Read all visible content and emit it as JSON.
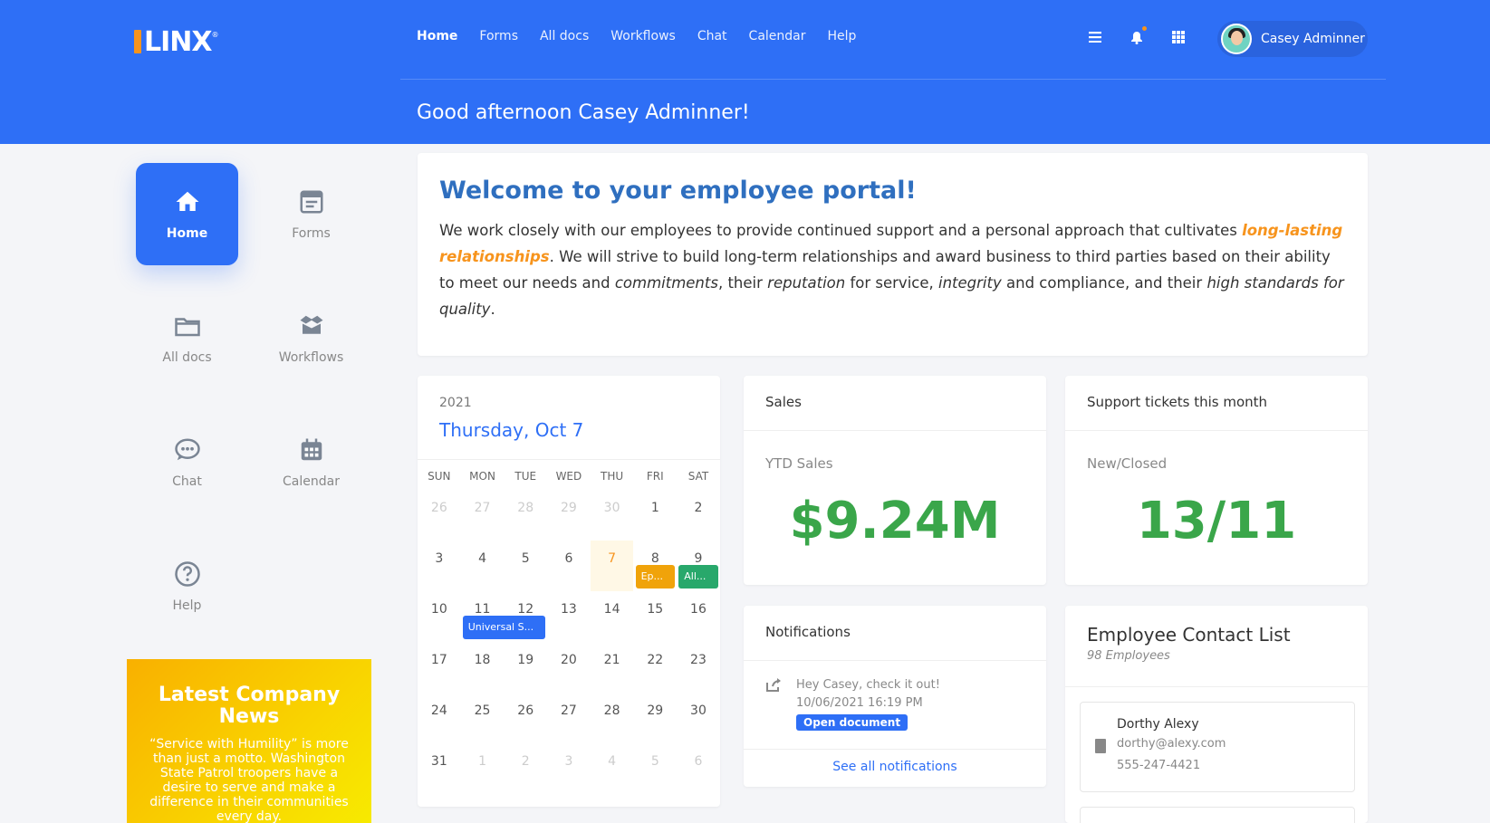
{
  "brand": {
    "logo_text": "LINX",
    "reg_mark": "®"
  },
  "nav": {
    "items": [
      "Home",
      "Forms",
      "All docs",
      "Workflows",
      "Chat",
      "Calendar",
      "Help"
    ],
    "active": "Home"
  },
  "header_icons": [
    "menu-icon",
    "bell-icon",
    "grid-icon"
  ],
  "user": {
    "name": "Casey Adminner"
  },
  "greeting": "Good afternoon Casey Adminner!",
  "sidebar": {
    "items": [
      {
        "label": "Home",
        "icon": "home-icon",
        "active": true
      },
      {
        "label": "Forms",
        "icon": "form-icon"
      },
      {
        "label": "All docs",
        "icon": "folder-icon"
      },
      {
        "label": "Workflows",
        "icon": "box-icon"
      },
      {
        "label": "Chat",
        "icon": "chat-icon"
      },
      {
        "label": "Calendar",
        "icon": "calendar-icon"
      },
      {
        "label": "Help",
        "icon": "help-icon"
      }
    ]
  },
  "news": {
    "title": "Latest Company News",
    "body": "“Service with Humility” is more than just a motto. Washington State Patrol troopers have a desire to serve and make a difference in their communities every day."
  },
  "welcome": {
    "title": "Welcome to your employee portal!",
    "p1": "We work closely with our employees to provide continued support and a personal approach that cultivates ",
    "highlight": "long-lasting relationships",
    "p2": ". We will strive to build long-term relationships and award business to third parties based on their ability to meet our needs and ",
    "em1": "commitments",
    "p3": ", their ",
    "em2": "reputation",
    "p4": " for service, ",
    "em3": "integrity",
    "p5": " and compliance, and their ",
    "em4": "high standards for quality",
    "p6": "."
  },
  "calendar": {
    "year": "2021",
    "date_label": "Thursday, Oct 7",
    "dow": [
      "SUN",
      "MON",
      "TUE",
      "WED",
      "THU",
      "FRI",
      "SAT"
    ],
    "weeks": [
      [
        "26",
        "27",
        "28",
        "29",
        "30",
        "1",
        "2"
      ],
      [
        "3",
        "4",
        "5",
        "6",
        "7",
        "8",
        "9"
      ],
      [
        "10",
        "11",
        "12",
        "13",
        "14",
        "15",
        "16"
      ],
      [
        "17",
        "18",
        "19",
        "20",
        "21",
        "22",
        "23"
      ],
      [
        "24",
        "25",
        "26",
        "27",
        "28",
        "29",
        "30"
      ],
      [
        "31",
        "1",
        "2",
        "3",
        "4",
        "5",
        "6"
      ]
    ],
    "muted": [
      [
        0,
        0
      ],
      [
        0,
        1
      ],
      [
        0,
        2
      ],
      [
        0,
        3
      ],
      [
        0,
        4
      ],
      [
        5,
        1
      ],
      [
        5,
        2
      ],
      [
        5,
        3
      ],
      [
        5,
        4
      ],
      [
        5,
        5
      ],
      [
        5,
        6
      ]
    ],
    "today": [
      1,
      4
    ],
    "events": [
      {
        "label": "Ep...",
        "color": "#f0a30a",
        "week": 1,
        "day": 5
      },
      {
        "label": "All...",
        "color": "#28a86b",
        "week": 1,
        "day": 6
      },
      {
        "label": "Universal S...",
        "color": "#2e6ff6",
        "week": 2,
        "day": 1,
        "span": 2
      }
    ]
  },
  "sales": {
    "title": "Sales",
    "sub": "YTD Sales",
    "value": "$9.24M"
  },
  "tickets": {
    "title": "Support tickets this month",
    "sub": "New/Closed",
    "value": "13/11"
  },
  "notifications": {
    "title": "Notifications",
    "item_text": "Hey Casey, check it out!",
    "item_time": "10/06/2021 16:19 PM",
    "item_button": "Open document",
    "see_all": "See all notifications"
  },
  "contacts": {
    "title": "Employee Contact List",
    "count": "98 Employees",
    "first": {
      "name": "Dorthy Alexy",
      "email": "dorthy@alexy.com",
      "phone": "555-247-4421"
    }
  },
  "colors": {
    "primary": "#2e6ff6",
    "accent": "#f7941d",
    "success": "#3aa64a"
  }
}
